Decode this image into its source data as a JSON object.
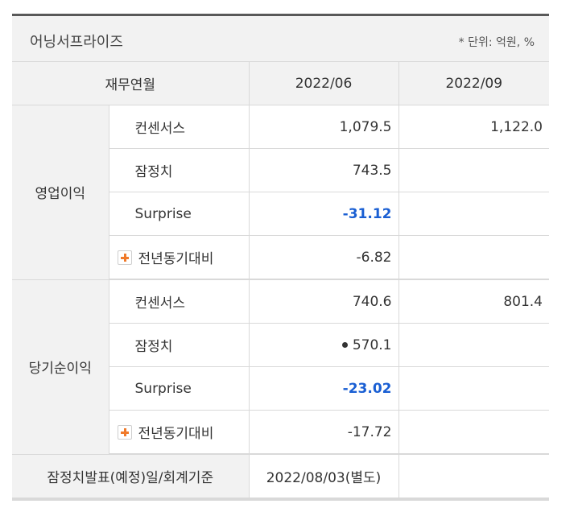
{
  "title": "어닝서프라이즈",
  "unit_note": "* 단위: 억원, %",
  "header": {
    "col_label": "재무연월",
    "periods": [
      "2022/06",
      "2022/09"
    ]
  },
  "groups": [
    {
      "name": "영업이익",
      "rows": [
        {
          "label": "컨센서스",
          "v1": "1,079.5",
          "v2": "1,122.0"
        },
        {
          "label": "잠정치",
          "v1": "743.5",
          "v2": ""
        },
        {
          "label": "Surprise",
          "v1": "-31.12",
          "v2": ""
        },
        {
          "label": "전년동기대비",
          "v1": "-6.82",
          "v2": ""
        }
      ]
    },
    {
      "name": "당기순이익",
      "rows": [
        {
          "label": "컨센서스",
          "v1": "740.6",
          "v2": "801.4"
        },
        {
          "label": "잠정치",
          "v1": "570.1",
          "v2": ""
        },
        {
          "label": "Surprise",
          "v1": "-23.02",
          "v2": ""
        },
        {
          "label": "전년동기대비",
          "v1": "-17.72",
          "v2": ""
        }
      ]
    }
  ],
  "footer": {
    "label": "잠정치발표(예정)일/회계기준",
    "value": "2022/08/03(별도)",
    "value2": ""
  },
  "colors": {
    "surprise": "#1a5fd3",
    "plus_icon": "#f07a2a"
  }
}
